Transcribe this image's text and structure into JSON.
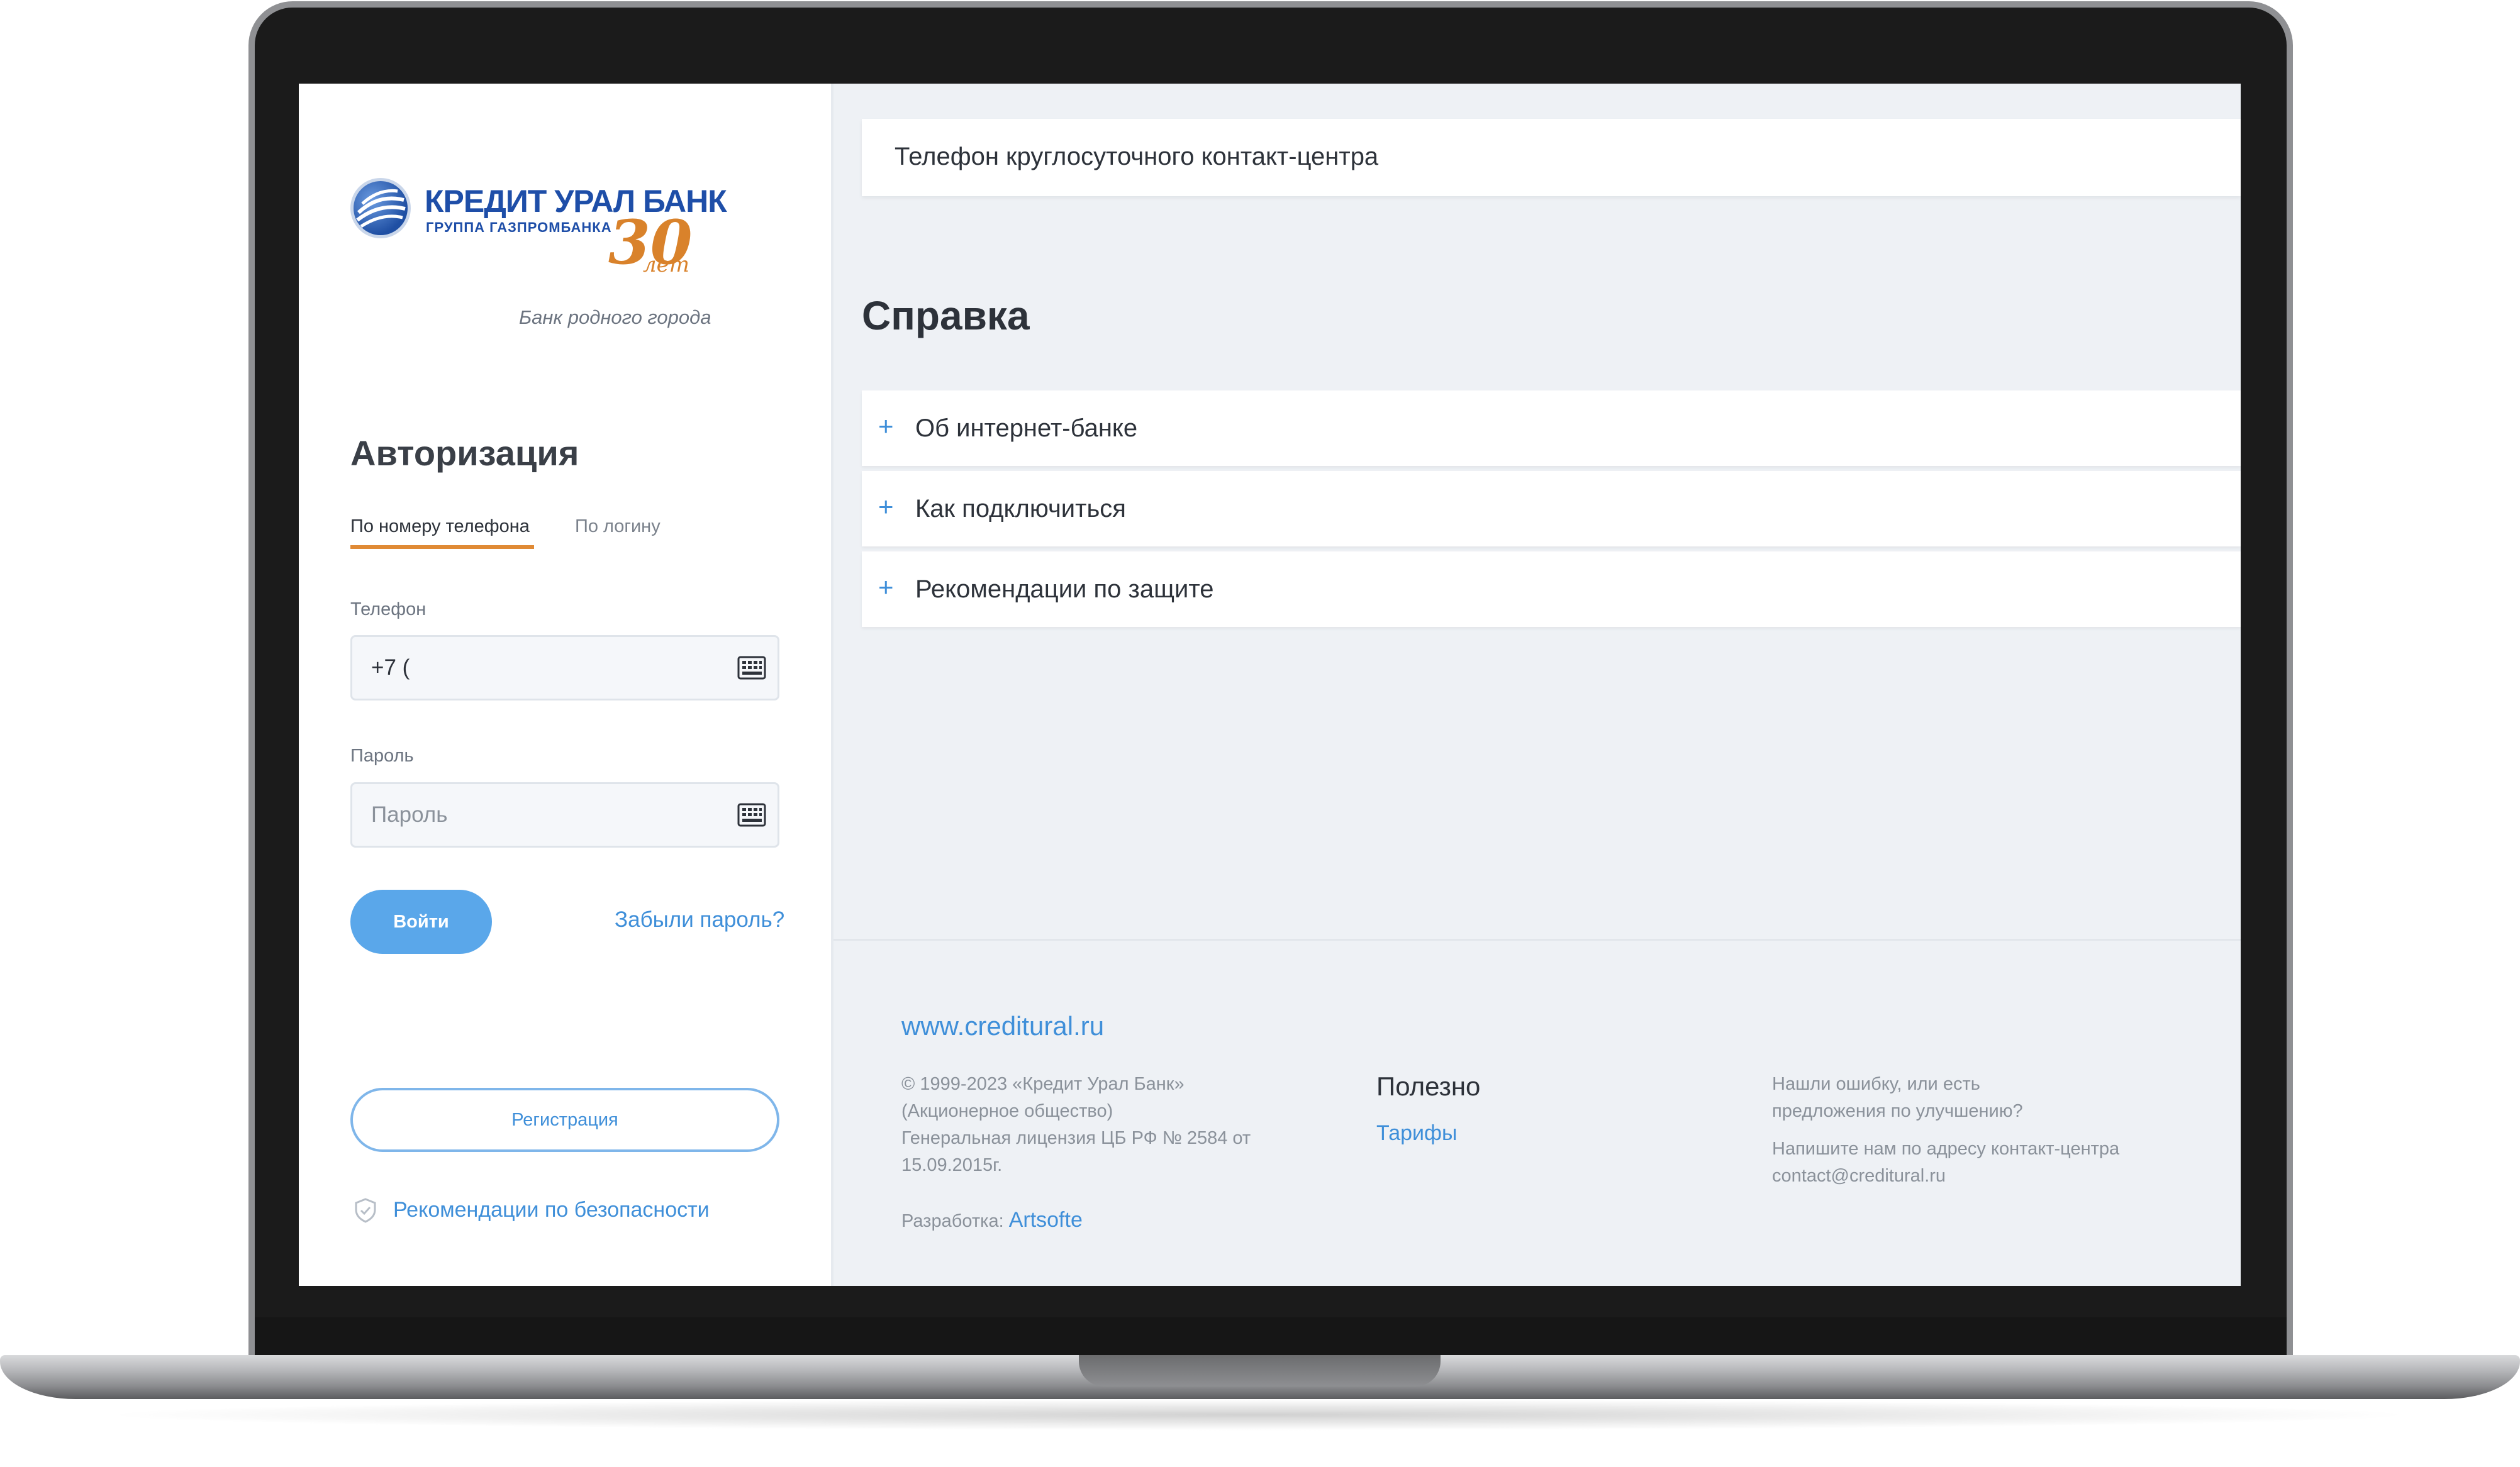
{
  "bank": {
    "name": "КРЕДИТ УРАЛ БАНК",
    "group": "ГРУППА ГАЗПРОМБАНКА",
    "anniversary_number": "30",
    "anniversary_word": "лет",
    "slogan": "Банк родного города"
  },
  "auth": {
    "title": "Авторизация",
    "tabs": [
      {
        "label": "По номеру телефона",
        "active": true
      },
      {
        "label": "По логину",
        "active": false
      }
    ],
    "phone": {
      "label": "Телефон",
      "value": "+7 ("
    },
    "password": {
      "label": "Пароль",
      "placeholder": "Пароль"
    },
    "login_button": "Войти",
    "forgot_link": "Забыли пароль?",
    "register_button": "Регистрация",
    "security_link": "Рекомендации по безопасности"
  },
  "main": {
    "contact_center": "Телефон круглосуточного контакт-центра",
    "help_title": "Справка",
    "accordion": [
      {
        "icon": "+",
        "label": "Об интернет-банке"
      },
      {
        "icon": "+",
        "label": "Как подключиться"
      },
      {
        "icon": "+",
        "label": "Рекомендации по защите"
      }
    ]
  },
  "footer": {
    "site": "www.creditural.ru",
    "copyright_lines": [
      "© 1999-2023 «Кредит Урал Банк»",
      "(Акционерное общество)",
      "Генеральная лицензия ЦБ РФ № 2584 от",
      "15.09.2015г."
    ],
    "dev_label": "Разработка:",
    "dev_link": "Artsofte",
    "useful_title": "Полезно",
    "useful_link": "Тарифы",
    "feedback_lines": [
      "Нашли ошибку, или есть",
      "предложения по улучшению?"
    ],
    "contact_lines": [
      "Напишите нам по адресу контакт-центра",
      "contact@creditural.ru"
    ]
  },
  "colors": {
    "accent_blue": "#3f8fd9",
    "button_blue": "#5aa7ea",
    "tab_underline": "#e08a35",
    "brand_blue": "#1e4ea8",
    "anniversary_orange": "#d9822b"
  }
}
